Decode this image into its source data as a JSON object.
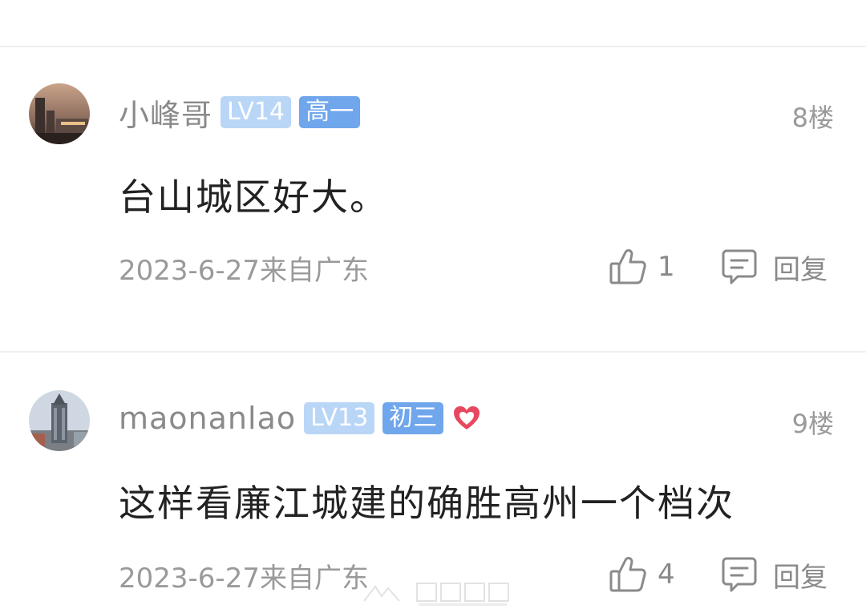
{
  "comments": [
    {
      "username": "小峰哥",
      "level": "LV14",
      "grade": "高一",
      "has_heart": false,
      "floor": "8楼",
      "text": "台山城区好大。",
      "meta": "2023-6-27来自广东",
      "likes": "1",
      "reply_label": "回复"
    },
    {
      "username": "maonanlao",
      "level": "LV13",
      "grade": "初三",
      "has_heart": true,
      "floor": "9楼",
      "text": "这样看廉江城建的确胜高州一个档次",
      "meta": "2023-6-27来自广东",
      "likes": "4",
      "reply_label": "回复"
    }
  ],
  "colors": {
    "badge_level": "#b9d6f7",
    "badge_grade": "#6fa6ec",
    "heart": "#e8485f",
    "muted_text": "#9a9a9a"
  },
  "icons": [
    "thumbs-up-icon",
    "comment-bubble-icon",
    "heart-icon"
  ]
}
